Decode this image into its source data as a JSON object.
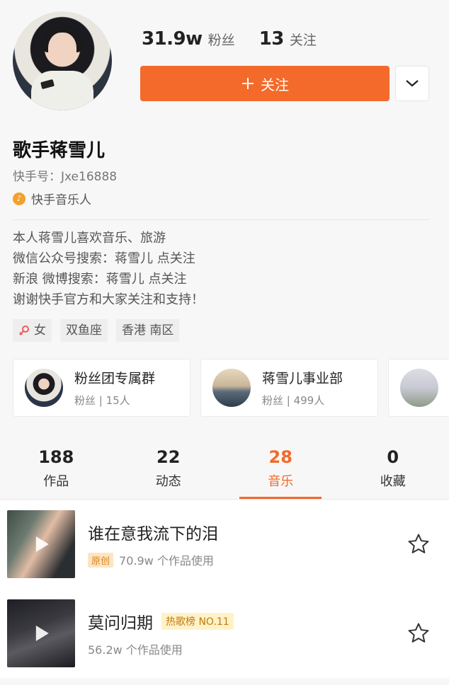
{
  "profile": {
    "fans_count": "31.9w",
    "fans_label": "粉丝",
    "following_count": "13",
    "following_label": "关注",
    "follow_button_label": "关注",
    "follow_button_icon": "plus-icon",
    "name": "歌手蒋雪儿",
    "kuaishou_id": "快手号：Jxe16888",
    "badge_label": "快手音乐人",
    "bio_lines": [
      "本人蒋雪儿喜欢音乐、旅游",
      "微信公众号搜索：蒋雪儿 点关注",
      "新浪  微博搜索：蒋雪儿 点关注",
      "谢谢快手官方和大家关注和支持！"
    ],
    "tags": [
      "女",
      "双鱼座",
      "香港 南区"
    ]
  },
  "groups": [
    {
      "title": "粉丝团专属群",
      "sub": "粉丝 | 15人"
    },
    {
      "title": "蒋雪儿事业部",
      "sub": "粉丝 | 499人"
    }
  ],
  "tabs": [
    {
      "num": "188",
      "label": "作品"
    },
    {
      "num": "22",
      "label": "动态"
    },
    {
      "num": "28",
      "label": "音乐"
    },
    {
      "num": "0",
      "label": "收藏"
    }
  ],
  "songs": [
    {
      "title": "谁在意我流下的泪",
      "tag": "原创",
      "meta": "70.9w 个作品使用"
    },
    {
      "title": "莫问归期",
      "tag": "热歌榜 NO.11",
      "meta": "56.2w 个作品使用"
    }
  ],
  "colors": {
    "accent": "#f36a2a",
    "badge": "#f4a02a"
  }
}
